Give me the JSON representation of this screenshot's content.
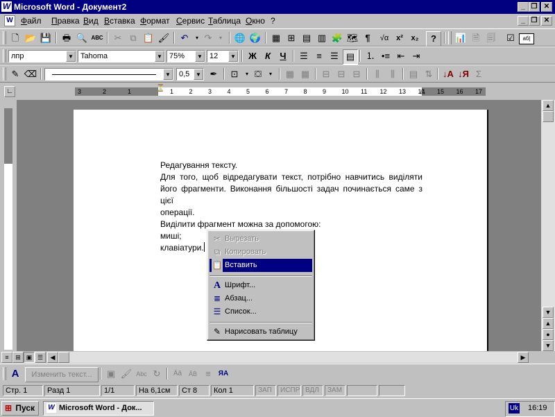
{
  "window": {
    "title": "Microsoft Word - Документ2"
  },
  "menu": [
    "Файл",
    "Правка",
    "Вид",
    "Вставка",
    "Формат",
    "Сервис",
    "Таблица",
    "Окно",
    "?"
  ],
  "format_bar": {
    "style": "лпр",
    "font": "Tahoma",
    "zoom": "75%",
    "size": "12",
    "bold": "Ж",
    "italic": "К",
    "underline": "Ч"
  },
  "tables_bar": {
    "line_weight": "0,5"
  },
  "standard_bar": {
    "spelling_label": "АВС",
    "pilcrow": "¶",
    "sqrt": "√α",
    "sup": "x²",
    "sub": "x₂",
    "help": "?",
    "zoom_label": "аб|"
  },
  "ruler": {
    "left_numbers": [
      "3",
      "2",
      "1"
    ],
    "numbers": [
      "1",
      "2",
      "3",
      "4",
      "5",
      "6",
      "7",
      "8",
      "9",
      "10",
      "11",
      "12",
      "13",
      "14",
      "15",
      "16",
      "17"
    ]
  },
  "document": {
    "lines": [
      "Редагування тексту.",
      "Для того, щоб відредагувати текст, потрібно навчитись виділяти",
      "його фрагменти. Виконання більшості задач починається саме з цієї",
      "операції.",
      "Виділити фрагмент можна за допомогою:",
      "миші;",
      "клавіатури."
    ]
  },
  "context_menu": {
    "items": [
      {
        "label": "Вырезать",
        "icon": "scissors-icon",
        "disabled": true
      },
      {
        "label": "Копировать",
        "icon": "copy-icon",
        "disabled": true
      },
      {
        "label": "Вставить",
        "icon": "paste-icon",
        "selected": true
      },
      {
        "label": "Шрифт...",
        "icon": "font-a-icon"
      },
      {
        "label": "Абзац...",
        "icon": "paragraph-icon"
      },
      {
        "label": "Список...",
        "icon": "list-icon"
      },
      {
        "label": "Нарисовать таблицу",
        "icon": "pencil-icon"
      }
    ]
  },
  "draw_bar": {
    "change_text": "Изменить текст...",
    "abc1": "Äā",
    "abc2": "ĀḂ",
    "ya": "ЯА"
  },
  "status_bar": {
    "page": "Стр. 1",
    "section": "Разд 1",
    "pages": "1/1",
    "at": "На 6,1см",
    "line": "Ст 8",
    "col": "Кол 1",
    "rec": "ЗАП",
    "trk": "ИСПР",
    "ext": "ВДЛ",
    "ovr": "ЗАМ"
  },
  "taskbar": {
    "start": "Пуск",
    "task": "Microsoft Word - Док...",
    "lang": "Uk",
    "time": "16:19"
  },
  "colors": {
    "title": "#000080",
    "face": "#c0c0c0",
    "highlight": "#000080"
  }
}
